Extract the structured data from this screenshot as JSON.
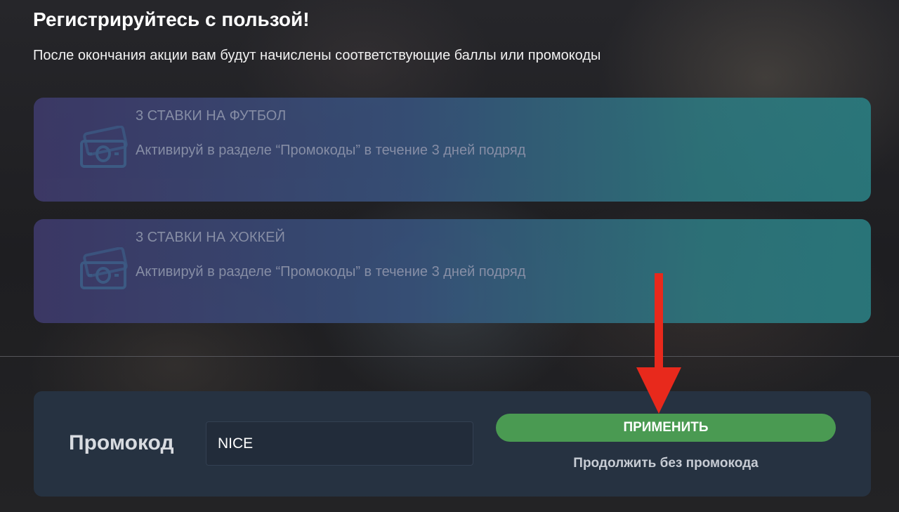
{
  "header": {
    "title": "Регистрируйтесь с пользой!",
    "subtitle": "После окончания акции вам будут начислены соответствующие баллы или промокоды"
  },
  "offers": [
    {
      "icon": "money-icon",
      "title": "3 СТАВКИ НА ФУТБОЛ",
      "description": "Активируй в разделе “Промокоды” в течение 3 дней подряд"
    },
    {
      "icon": "money-icon",
      "title": "3 СТАВКИ НА ХОККЕЙ",
      "description": "Активируй в разделе “Промокоды” в течение 3 дней подряд"
    }
  ],
  "promo": {
    "label": "Промокод",
    "value": "NICE",
    "apply_label": "ПРИМЕНИТЬ",
    "skip_label": "Продолжить без промокода"
  },
  "colors": {
    "apply_button": "#4a9a52",
    "arrow": "#e8291c",
    "panel": "#263241"
  }
}
